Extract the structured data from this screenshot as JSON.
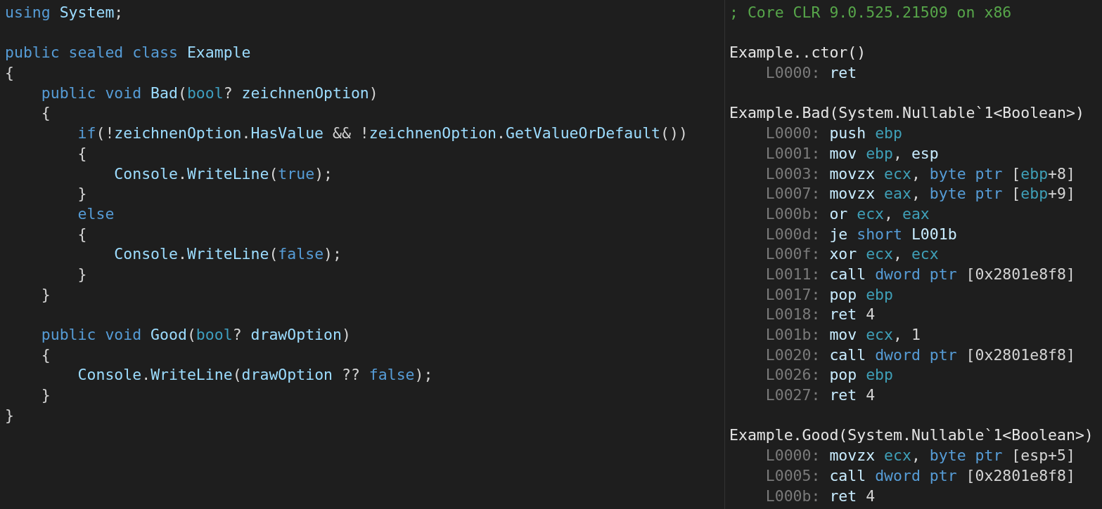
{
  "source_pane": {
    "lines": [
      {
        "kind": "code",
        "tokens": [
          {
            "kind": "keyword",
            "text": "using "
          },
          {
            "kind": "ident",
            "text": "System"
          },
          {
            "kind": "plain",
            "text": ";"
          }
        ]
      },
      {
        "kind": "blank"
      },
      {
        "kind": "code",
        "tokens": [
          {
            "kind": "keyword",
            "text": "public sealed class "
          },
          {
            "kind": "ident",
            "text": "Example"
          }
        ]
      },
      {
        "kind": "code",
        "tokens": [
          {
            "kind": "plain",
            "text": "{"
          }
        ]
      },
      {
        "kind": "code",
        "tokens": [
          {
            "kind": "keyword",
            "text": "    public void "
          },
          {
            "kind": "ident",
            "text": "Bad"
          },
          {
            "kind": "plain",
            "text": "("
          },
          {
            "kind": "type",
            "text": "bool"
          },
          {
            "kind": "plain",
            "text": "? "
          },
          {
            "kind": "ident",
            "text": "zeichnenOption"
          },
          {
            "kind": "plain",
            "text": ")"
          }
        ]
      },
      {
        "kind": "code",
        "tokens": [
          {
            "kind": "plain",
            "text": "    {"
          }
        ]
      },
      {
        "kind": "code",
        "tokens": [
          {
            "kind": "keyword",
            "text": "        if"
          },
          {
            "kind": "plain",
            "text": "(!"
          },
          {
            "kind": "ident",
            "text": "zeichnenOption"
          },
          {
            "kind": "plain",
            "text": "."
          },
          {
            "kind": "ident",
            "text": "HasValue"
          },
          {
            "kind": "plain",
            "text": " && !"
          },
          {
            "kind": "ident",
            "text": "zeichnenOption"
          },
          {
            "kind": "plain",
            "text": "."
          },
          {
            "kind": "ident",
            "text": "GetValueOrDefault"
          },
          {
            "kind": "plain",
            "text": "())"
          }
        ]
      },
      {
        "kind": "code",
        "tokens": [
          {
            "kind": "plain",
            "text": "        {"
          }
        ]
      },
      {
        "kind": "code",
        "tokens": [
          {
            "kind": "ident",
            "text": "            Console"
          },
          {
            "kind": "plain",
            "text": "."
          },
          {
            "kind": "ident",
            "text": "WriteLine"
          },
          {
            "kind": "plain",
            "text": "("
          },
          {
            "kind": "keyword",
            "text": "true"
          },
          {
            "kind": "plain",
            "text": ");"
          }
        ]
      },
      {
        "kind": "code",
        "tokens": [
          {
            "kind": "plain",
            "text": "        }"
          }
        ]
      },
      {
        "kind": "code",
        "tokens": [
          {
            "kind": "keyword",
            "text": "        else"
          }
        ]
      },
      {
        "kind": "code",
        "tokens": [
          {
            "kind": "plain",
            "text": "        {"
          }
        ]
      },
      {
        "kind": "code",
        "tokens": [
          {
            "kind": "ident",
            "text": "            Console"
          },
          {
            "kind": "plain",
            "text": "."
          },
          {
            "kind": "ident",
            "text": "WriteLine"
          },
          {
            "kind": "plain",
            "text": "("
          },
          {
            "kind": "keyword",
            "text": "false"
          },
          {
            "kind": "plain",
            "text": ");"
          }
        ]
      },
      {
        "kind": "code",
        "tokens": [
          {
            "kind": "plain",
            "text": "        }"
          }
        ]
      },
      {
        "kind": "code",
        "tokens": [
          {
            "kind": "plain",
            "text": "    }"
          }
        ]
      },
      {
        "kind": "blank"
      },
      {
        "kind": "code",
        "tokens": [
          {
            "kind": "keyword",
            "text": "    public void "
          },
          {
            "kind": "ident",
            "text": "Good"
          },
          {
            "kind": "plain",
            "text": "("
          },
          {
            "kind": "type",
            "text": "bool"
          },
          {
            "kind": "plain",
            "text": "? "
          },
          {
            "kind": "ident",
            "text": "drawOption"
          },
          {
            "kind": "plain",
            "text": ")"
          }
        ]
      },
      {
        "kind": "code",
        "tokens": [
          {
            "kind": "plain",
            "text": "    {"
          }
        ]
      },
      {
        "kind": "code",
        "tokens": [
          {
            "kind": "ident",
            "text": "        Console"
          },
          {
            "kind": "plain",
            "text": "."
          },
          {
            "kind": "ident",
            "text": "WriteLine"
          },
          {
            "kind": "plain",
            "text": "("
          },
          {
            "kind": "ident",
            "text": "drawOption"
          },
          {
            "kind": "plain",
            "text": " ?? "
          },
          {
            "kind": "keyword",
            "text": "false"
          },
          {
            "kind": "plain",
            "text": ");"
          }
        ]
      },
      {
        "kind": "code",
        "tokens": [
          {
            "kind": "plain",
            "text": "    }"
          }
        ]
      },
      {
        "kind": "code",
        "tokens": [
          {
            "kind": "plain",
            "text": "}"
          }
        ]
      }
    ]
  },
  "output_pane": {
    "lines": [
      {
        "kind": "code",
        "tokens": [
          {
            "kind": "comment",
            "text": "; Core CLR 9.0.525.21509 on x86"
          }
        ]
      },
      {
        "kind": "blank"
      },
      {
        "kind": "code",
        "tokens": [
          {
            "kind": "header",
            "text": "Example..ctor()"
          }
        ]
      },
      {
        "kind": "code",
        "tokens": [
          {
            "kind": "label",
            "text": "    L0000: "
          },
          {
            "kind": "op",
            "text": "ret"
          }
        ]
      },
      {
        "kind": "blank"
      },
      {
        "kind": "code",
        "tokens": [
          {
            "kind": "header",
            "text": "Example.Bad(System.Nullable`1<Boolean>)"
          }
        ]
      },
      {
        "kind": "code",
        "tokens": [
          {
            "kind": "label",
            "text": "    L0000: "
          },
          {
            "kind": "op",
            "text": "push "
          },
          {
            "kind": "register",
            "text": "ebp"
          }
        ]
      },
      {
        "kind": "code",
        "tokens": [
          {
            "kind": "label",
            "text": "    L0001: "
          },
          {
            "kind": "op",
            "text": "mov "
          },
          {
            "kind": "register",
            "text": "ebp"
          },
          {
            "kind": "plain",
            "text": ", "
          },
          {
            "kind": "op",
            "text": "esp"
          }
        ]
      },
      {
        "kind": "code",
        "tokens": [
          {
            "kind": "label",
            "text": "    L0003: "
          },
          {
            "kind": "op",
            "text": "movzx "
          },
          {
            "kind": "register",
            "text": "ecx"
          },
          {
            "kind": "plain",
            "text": ", "
          },
          {
            "kind": "keyword",
            "text": "byte ptr "
          },
          {
            "kind": "plain",
            "text": "["
          },
          {
            "kind": "register",
            "text": "ebp"
          },
          {
            "kind": "plain",
            "text": "+8]"
          }
        ]
      },
      {
        "kind": "code",
        "tokens": [
          {
            "kind": "label",
            "text": "    L0007: "
          },
          {
            "kind": "op",
            "text": "movzx "
          },
          {
            "kind": "register",
            "text": "eax"
          },
          {
            "kind": "plain",
            "text": ", "
          },
          {
            "kind": "keyword",
            "text": "byte ptr "
          },
          {
            "kind": "plain",
            "text": "["
          },
          {
            "kind": "register",
            "text": "ebp"
          },
          {
            "kind": "plain",
            "text": "+9]"
          }
        ]
      },
      {
        "kind": "code",
        "tokens": [
          {
            "kind": "label",
            "text": "    L000b: "
          },
          {
            "kind": "op",
            "text": "or "
          },
          {
            "kind": "register",
            "text": "ecx"
          },
          {
            "kind": "plain",
            "text": ", "
          },
          {
            "kind": "register",
            "text": "eax"
          }
        ]
      },
      {
        "kind": "code",
        "tokens": [
          {
            "kind": "label",
            "text": "    L000d: "
          },
          {
            "kind": "op",
            "text": "je "
          },
          {
            "kind": "keyword",
            "text": "short "
          },
          {
            "kind": "op",
            "text": "L001b"
          }
        ]
      },
      {
        "kind": "code",
        "tokens": [
          {
            "kind": "label",
            "text": "    L000f: "
          },
          {
            "kind": "op",
            "text": "xor "
          },
          {
            "kind": "register",
            "text": "ecx"
          },
          {
            "kind": "plain",
            "text": ", "
          },
          {
            "kind": "register",
            "text": "ecx"
          }
        ]
      },
      {
        "kind": "code",
        "tokens": [
          {
            "kind": "label",
            "text": "    L0011: "
          },
          {
            "kind": "op",
            "text": "call "
          },
          {
            "kind": "keyword",
            "text": "dword ptr "
          },
          {
            "kind": "plain",
            "text": "[0x2801e8f8]"
          }
        ]
      },
      {
        "kind": "code",
        "tokens": [
          {
            "kind": "label",
            "text": "    L0017: "
          },
          {
            "kind": "op",
            "text": "pop "
          },
          {
            "kind": "register",
            "text": "ebp"
          }
        ]
      },
      {
        "kind": "code",
        "tokens": [
          {
            "kind": "label",
            "text": "    L0018: "
          },
          {
            "kind": "op",
            "text": "ret "
          },
          {
            "kind": "plain",
            "text": "4"
          }
        ]
      },
      {
        "kind": "code",
        "tokens": [
          {
            "kind": "label",
            "text": "    L001b: "
          },
          {
            "kind": "op",
            "text": "mov "
          },
          {
            "kind": "register",
            "text": "ecx"
          },
          {
            "kind": "plain",
            "text": ", 1"
          }
        ]
      },
      {
        "kind": "code",
        "tokens": [
          {
            "kind": "label",
            "text": "    L0020: "
          },
          {
            "kind": "op",
            "text": "call "
          },
          {
            "kind": "keyword",
            "text": "dword ptr "
          },
          {
            "kind": "plain",
            "text": "[0x2801e8f8]"
          }
        ]
      },
      {
        "kind": "code",
        "tokens": [
          {
            "kind": "label",
            "text": "    L0026: "
          },
          {
            "kind": "op",
            "text": "pop "
          },
          {
            "kind": "register",
            "text": "ebp"
          }
        ]
      },
      {
        "kind": "code",
        "tokens": [
          {
            "kind": "label",
            "text": "    L0027: "
          },
          {
            "kind": "op",
            "text": "ret "
          },
          {
            "kind": "plain",
            "text": "4"
          }
        ]
      },
      {
        "kind": "blank"
      },
      {
        "kind": "code",
        "tokens": [
          {
            "kind": "header",
            "text": "Example.Good(System.Nullable`1<Boolean>)"
          }
        ]
      },
      {
        "kind": "code",
        "tokens": [
          {
            "kind": "label",
            "text": "    L0000: "
          },
          {
            "kind": "op",
            "text": "movzx "
          },
          {
            "kind": "register",
            "text": "ecx"
          },
          {
            "kind": "plain",
            "text": ", "
          },
          {
            "kind": "keyword",
            "text": "byte ptr "
          },
          {
            "kind": "plain",
            "text": "[esp+5]"
          }
        ]
      },
      {
        "kind": "code",
        "tokens": [
          {
            "kind": "label",
            "text": "    L0005: "
          },
          {
            "kind": "op",
            "text": "call "
          },
          {
            "kind": "keyword",
            "text": "dword ptr "
          },
          {
            "kind": "plain",
            "text": "[0x2801e8f8]"
          }
        ]
      },
      {
        "kind": "code",
        "tokens": [
          {
            "kind": "label",
            "text": "    L000b: "
          },
          {
            "kind": "op",
            "text": "ret "
          },
          {
            "kind": "plain",
            "text": "4"
          }
        ]
      }
    ]
  }
}
